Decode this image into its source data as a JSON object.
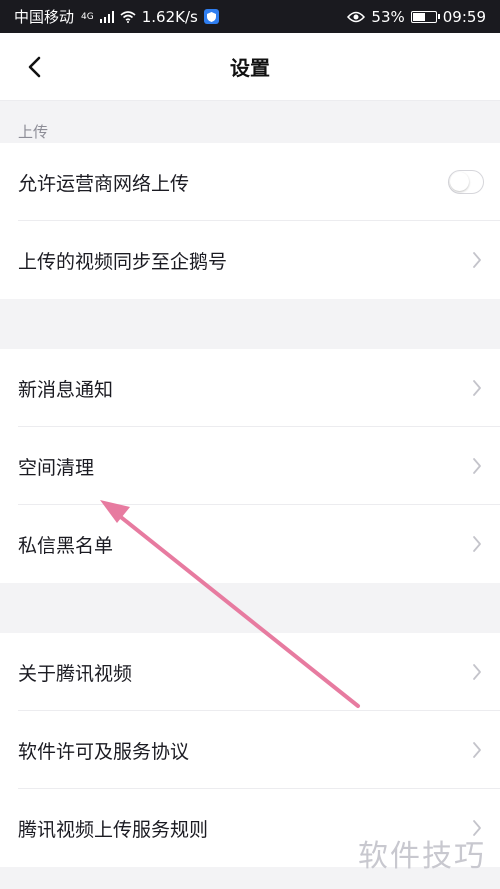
{
  "status_bar": {
    "carrier": "中国移动",
    "network": "4G",
    "speed": "1.62K/s",
    "battery": "53%",
    "time": "09:59"
  },
  "nav": {
    "title": "设置"
  },
  "sections": {
    "upload_label": "上传"
  },
  "rows": {
    "cellular_upload": {
      "label": "允许运营商网络上传",
      "toggle_on": false
    },
    "sync_penguin": {
      "label": "上传的视频同步至企鹅号"
    },
    "notifications": {
      "label": "新消息通知"
    },
    "storage_cleanup": {
      "label": "空间清理"
    },
    "dm_blacklist": {
      "label": "私信黑名单"
    },
    "about": {
      "label": "关于腾讯视频"
    },
    "license": {
      "label": "软件许可及服务协议"
    },
    "upload_rules": {
      "label": "腾讯视频上传服务规则"
    }
  },
  "watermark": "软件技巧",
  "colors": {
    "arrow": "#e77ba0",
    "background": "#f3f3f5",
    "status_bar": "#1a1a1f",
    "chevron": "#c4c4cb"
  }
}
